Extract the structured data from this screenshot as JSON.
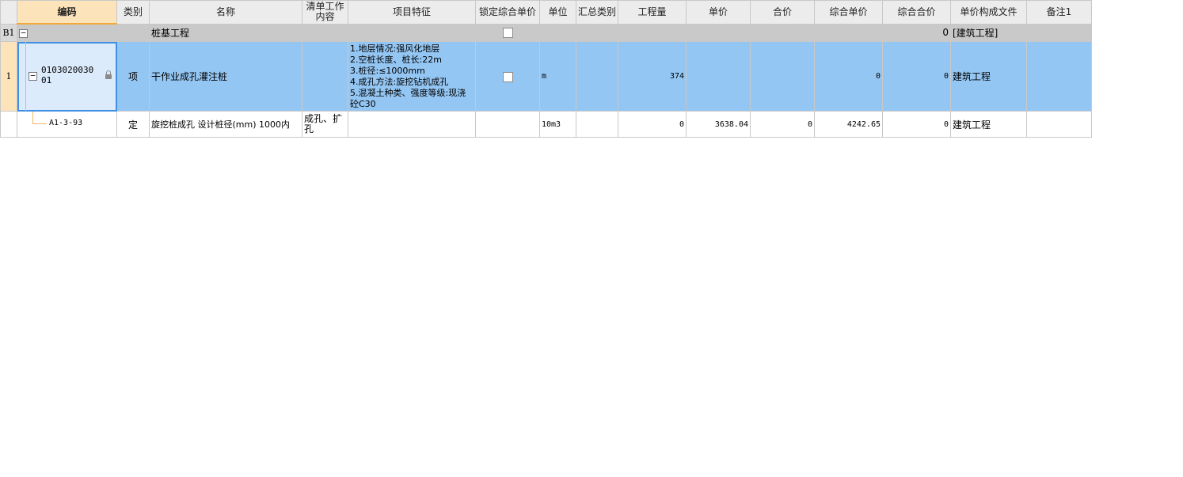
{
  "columns": [
    "编码",
    "类别",
    "名称",
    "清单工作内容",
    "项目特征",
    "锁定综合单价",
    "单位",
    "汇总类别",
    "工程量",
    "单价",
    "合价",
    "综合单价",
    "综合合价",
    "单价构成文件",
    "备注1"
  ],
  "rows": {
    "group": {
      "row_no": "B1",
      "expand": "−",
      "name": "桩基工程",
      "total": "0",
      "file": "[建筑工程]"
    },
    "item": {
      "row_no": "1",
      "expand": "−",
      "code": "010302003001",
      "type": "项",
      "name": "干作业成孔灌注桩",
      "features": "1.地层情况:强风化地层\n2.空桩长度、桩长:22m\n3.桩径:≤1000mm\n4.成孔方法:旋挖钻机成孔\n5.混凝土种类、强度等级:现浇砼C30",
      "unit": "m",
      "quantity": "374",
      "unit_total": "0",
      "total": "0",
      "file": "建筑工程"
    },
    "sub": {
      "code": "A1-3-93",
      "type": "定",
      "name": "旋挖桩成孔 设计桩径(mm) 1000内",
      "work": "成孔、扩孔",
      "unit": "10m3",
      "quantity": "0",
      "price": "3638.04",
      "amount": "0",
      "unit_total": "4242.65",
      "total": "0",
      "file": "建筑工程"
    }
  },
  "colors": {
    "header_bg": "#ececec",
    "selected_header": "#fde3ba",
    "group_row": "#c9c9c9",
    "highlight_row": "#94c6f3",
    "selection_border": "#3f8fe4"
  }
}
